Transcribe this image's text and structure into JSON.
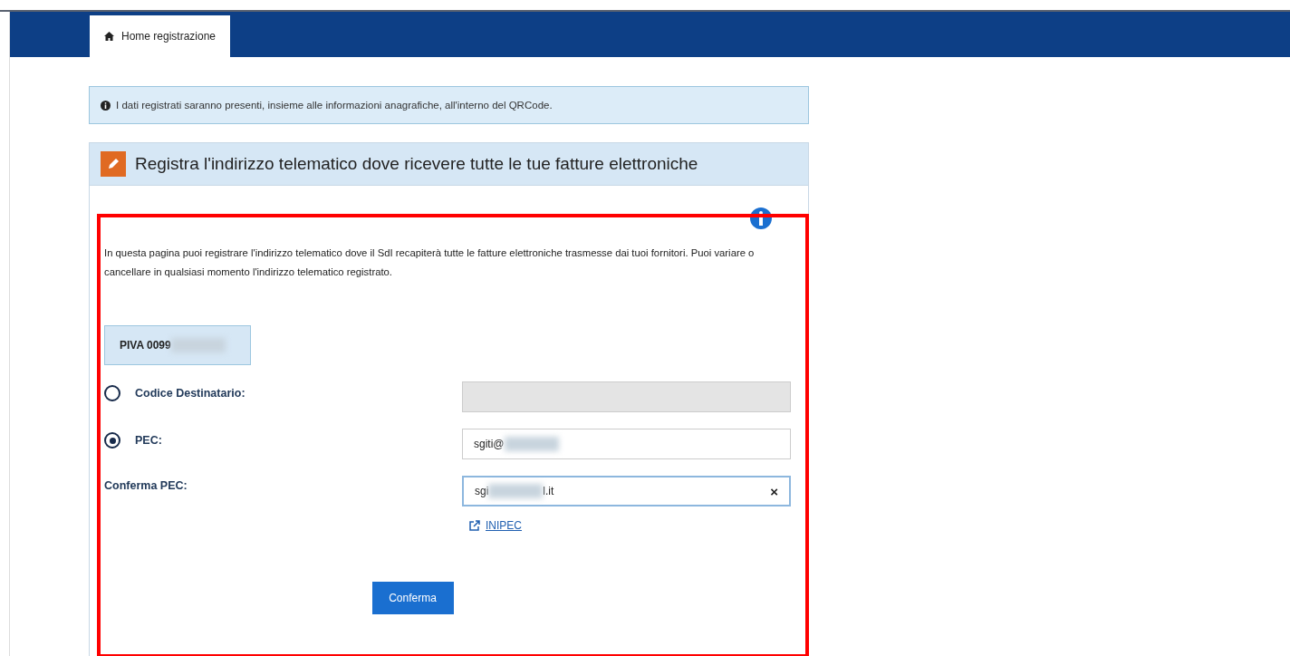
{
  "nav": {
    "tabs": [
      {
        "label": "Home registrazione",
        "selected": true
      }
    ]
  },
  "alert": {
    "text": "I dati registrati saranno presenti, insieme alle informazioni anagrafiche, all'interno del QRCode."
  },
  "panel": {
    "title": "Registra l'indirizzo telematico dove ricevere tutte le tue fatture elettroniche",
    "highlighted": true,
    "description": "In questa pagina puoi registrare l'indirizzo telematico dove il SdI recapiterà tutte le fatture elettroniche trasmesse dai tuoi fornitori. Puoi variare o cancellare in qualsiasi momento l'indirizzo telematico registrato.",
    "piva": [
      {
        "kind": "text",
        "text": "PIVA 0099"
      },
      {
        "kind": "blur"
      }
    ],
    "options": [
      {
        "label": "Codice Destinatario:",
        "selected": false,
        "disabled": true
      },
      {
        "label": "PEC:",
        "selected": true,
        "disabled": false,
        "value": [
          {
            "kind": "text",
            "text": "sgiti@"
          },
          {
            "kind": "blur"
          }
        ]
      }
    ],
    "confirm": {
      "label": "Conferma PEC:",
      "value": [
        {
          "kind": "text",
          "text": "sgi"
        },
        {
          "kind": "blur"
        },
        {
          "kind": "text",
          "text": "l.it"
        }
      ],
      "clear": "×"
    },
    "link": "INIPEC",
    "button": "Conferma"
  }
}
